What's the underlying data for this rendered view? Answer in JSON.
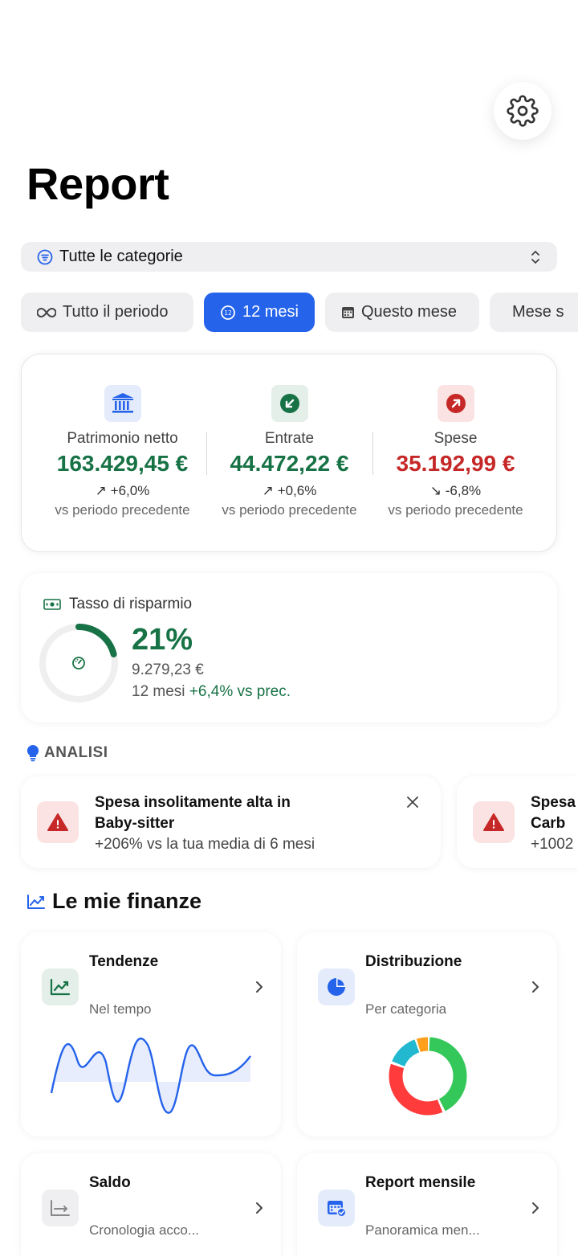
{
  "header": {
    "title": "Report",
    "settings_icon": "gear-icon"
  },
  "category_filter": {
    "icon": "filter-lines-icon",
    "selected": "Tutte le categorie",
    "chevron_icon": "chevron-up-down-icon"
  },
  "periods": [
    {
      "label": "Tutto il periodo",
      "icon": "infinity-icon",
      "active": false
    },
    {
      "label": "12 mesi",
      "icon": "twelve-circle-icon",
      "active": true
    },
    {
      "label": "Questo mese",
      "icon": "calendar-icon",
      "active": false
    },
    {
      "label": "Mese s",
      "icon": "calendar-clock-icon",
      "active": false
    }
  ],
  "summary": {
    "compare_label": "vs periodo precedente",
    "metrics": [
      {
        "label": "Patrimonio netto",
        "value": "163.429,45 €",
        "delta": "↗ +6,0%",
        "color": "#177245",
        "icon": "bank-icon",
        "icon_bg": "#e4ebfb"
      },
      {
        "label": "Entrate",
        "value": "44.472,22 €",
        "delta": "↗ +0,6%",
        "color": "#177245",
        "icon": "arrow-down-left-circle-icon",
        "icon_bg": "#e4efe9"
      },
      {
        "label": "Spese",
        "value": "35.192,99 €",
        "delta": "↘ -6,8%",
        "color": "#c62828",
        "icon": "arrow-up-right-circle-icon",
        "icon_bg": "#fbe3e3"
      }
    ]
  },
  "savings": {
    "title": "Tasso di risparmio",
    "percent": "21%",
    "gauge_fraction": 0.21,
    "amount": "9.279,23 €",
    "period": "12 mesi",
    "delta": "+6,4% vs prec."
  },
  "analysis": {
    "title": "ANALISI",
    "insights": [
      {
        "title": "Spesa insolitamente alta in Baby-sitter",
        "detail": "+206% vs la tua media di 6 mesi"
      },
      {
        "title": "Spesa insolitamente alta in Carb",
        "detail": "+1002"
      }
    ]
  },
  "finances": {
    "title": "Le mie finanze",
    "tiles": [
      {
        "title": "Tendenze",
        "subtitle": "Nel tempo",
        "icon": "trend-chart-icon"
      },
      {
        "title": "Distribuzione",
        "subtitle": "Per categoria",
        "icon": "pie-chart-icon"
      },
      {
        "title": "Saldo",
        "subtitle": "Cronologia acco...",
        "icon": "balance-axis-icon"
      },
      {
        "title": "Report mensile",
        "subtitle": "Panoramica men...",
        "icon": "calendar-check-icon"
      }
    ]
  },
  "colors": {
    "accent": "#2563eb",
    "positive": "#177245",
    "negative": "#c62828",
    "donut": [
      "#34c759",
      "#ff3b3b",
      "#22b8cf",
      "#ff9f1c"
    ]
  }
}
